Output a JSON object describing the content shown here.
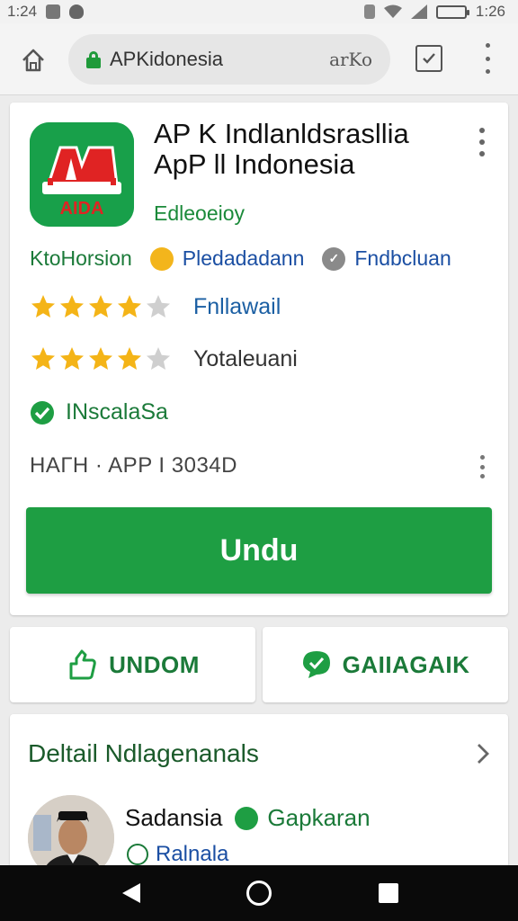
{
  "status_bar": {
    "time_left": "1:24",
    "time_right": "1:26"
  },
  "browser": {
    "url": "APKidonesia",
    "url_suffix": "arKo"
  },
  "app": {
    "title_line1": "AP K Indlanldsrasllia",
    "title_line2": "ApP ll Indonesia",
    "developer": "Edleoeioy",
    "icon_text": "AIDA",
    "meta": {
      "label1": "KtoHorsion",
      "label2": "Pledadadann",
      "label3": "Fndbcluan"
    },
    "rating_rows": [
      {
        "label": "Fnllawail",
        "stars": 4
      },
      {
        "label": "Yotaleuani",
        "stars": 4
      }
    ],
    "installed_label": "INscalaSa",
    "version_text": "HAГH · APP I 3034D",
    "download_label": "Undu"
  },
  "actions": {
    "left_label": "UNDOM",
    "right_label": "GAIIAGAIK"
  },
  "details": {
    "title": "Deltail Ndlagenanals",
    "reviewer_name": "Sadansia",
    "reviewer_badge": "Gapkaran",
    "reviewer_sub": "Ralnala"
  },
  "colors": {
    "brand_green": "#1e9e43",
    "star_gold": "#f4b417",
    "link_blue": "#1b4fa3"
  }
}
